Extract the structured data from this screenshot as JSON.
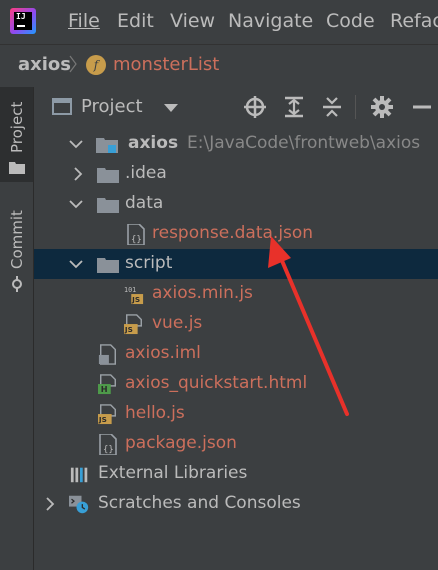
{
  "menu": {
    "items": [
      {
        "label": "File"
      },
      {
        "label": "Edit"
      },
      {
        "label": "View"
      },
      {
        "label": "Navigate"
      },
      {
        "label": "Code"
      },
      {
        "label": "Refac"
      }
    ]
  },
  "logo": {
    "text": "IJ"
  },
  "breadcrumb": {
    "root": "axios",
    "func_letter": "f",
    "func": "monsterList"
  },
  "sidebar": {
    "project": "Project",
    "commit": "Commit"
  },
  "panel": {
    "title": "Project"
  },
  "tree": {
    "root": {
      "name": "axios",
      "path": "E:\\JavaCode\\frontweb\\axios"
    },
    "idea": ".idea",
    "data": "data",
    "response": "response.data.json",
    "script": "script",
    "axios_min": "axios.min.js",
    "vue": "vue.js",
    "iml": "axios.iml",
    "quickstart": "axios_quickstart.html",
    "hello": "hello.js",
    "package": "package.json",
    "external": "External Libraries",
    "scratches": "Scratches and Consoles"
  },
  "icons": {
    "json_badge": "{}",
    "js_badge": "JS",
    "html_badge": "H",
    "binary_badge": "101"
  },
  "colors": {
    "modified_file": "#cc6f5c",
    "selected_row": "#0d293e",
    "annotation_arrow": "#e8312a"
  }
}
